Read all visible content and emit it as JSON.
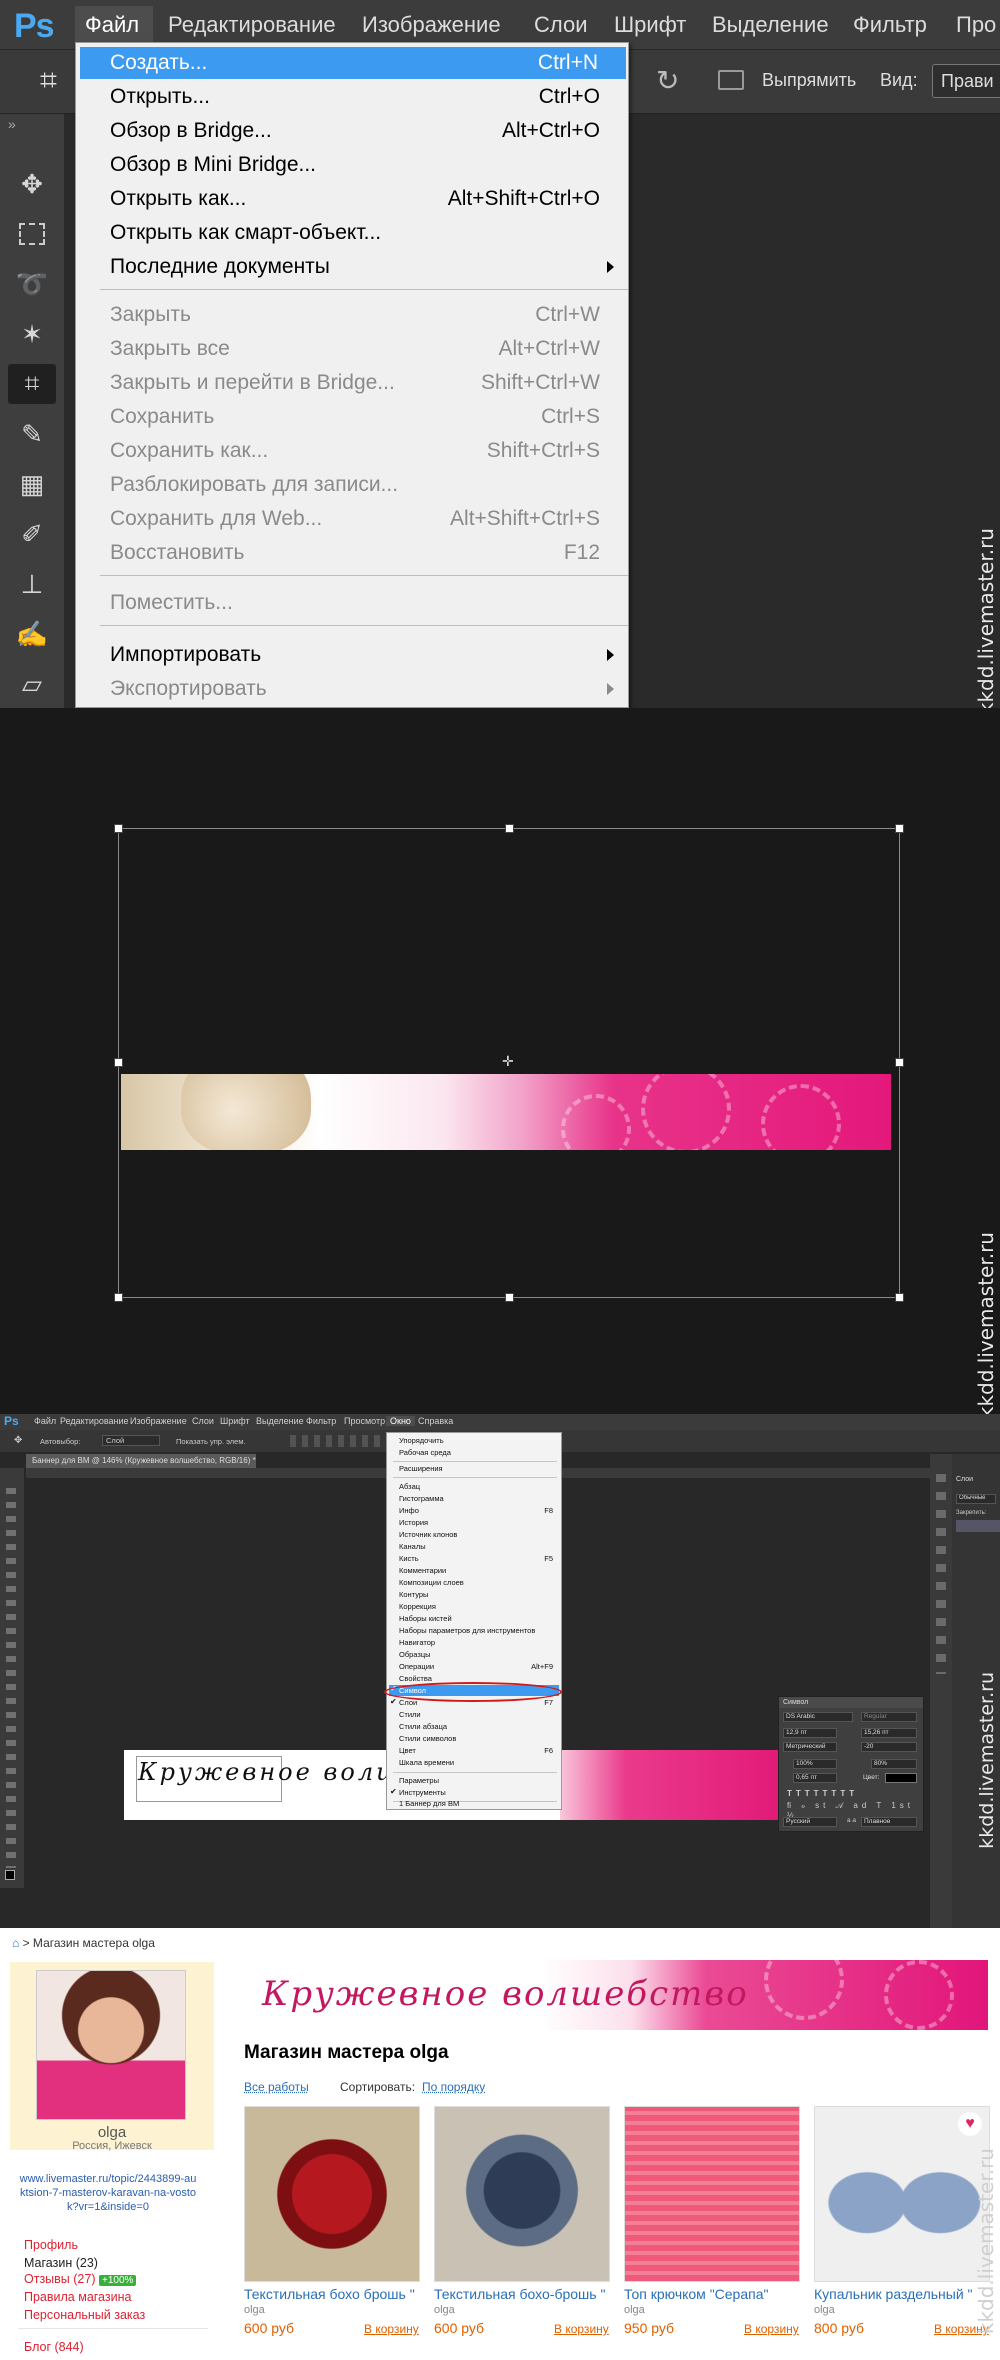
{
  "watermark": "kkdd.livemaster.ru",
  "p1": {
    "logo": "Ps",
    "menubar": [
      "Файл",
      "Редактирование",
      "Изображение",
      "Слои",
      "Шрифт",
      "Выделение",
      "Фильтр",
      "Про"
    ],
    "options": {
      "straighten": "Выпрямить",
      "view_label": "Вид:",
      "view_value": "Прави"
    },
    "file_menu": [
      {
        "label": "Создать...",
        "shortcut": "Ctrl+N",
        "state": "highlighted"
      },
      {
        "label": "Открыть...",
        "shortcut": "Ctrl+O"
      },
      {
        "label": "Обзор в Bridge...",
        "shortcut": "Alt+Ctrl+O"
      },
      {
        "label": "Обзор в Mini Bridge...",
        "shortcut": ""
      },
      {
        "label": "Открыть как...",
        "shortcut": "Alt+Shift+Ctrl+O"
      },
      {
        "label": "Открыть как смарт-объект...",
        "shortcut": ""
      },
      {
        "label": "Последние документы",
        "shortcut": "",
        "submenu": true
      },
      {
        "label": "Закрыть",
        "shortcut": "Ctrl+W",
        "state": "disabled"
      },
      {
        "label": "Закрыть все",
        "shortcut": "Alt+Ctrl+W",
        "state": "disabled"
      },
      {
        "label": "Закрыть и перейти в Bridge...",
        "shortcut": "Shift+Ctrl+W",
        "state": "disabled"
      },
      {
        "label": "Сохранить",
        "shortcut": "Ctrl+S",
        "state": "disabled"
      },
      {
        "label": "Сохранить как...",
        "shortcut": "Shift+Ctrl+S",
        "state": "disabled"
      },
      {
        "label": "Разблокировать для записи...",
        "shortcut": "",
        "state": "disabled"
      },
      {
        "label": "Сохранить для Web...",
        "shortcut": "Alt+Shift+Ctrl+S",
        "state": "disabled"
      },
      {
        "label": "Восстановить",
        "shortcut": "F12",
        "state": "disabled"
      },
      {
        "label": "Поместить...",
        "shortcut": "",
        "state": "disabled"
      },
      {
        "label": "Импортировать",
        "shortcut": "",
        "submenu": true
      },
      {
        "label": "Экспортировать",
        "shortcut": "",
        "submenu": true,
        "state": "disabled"
      }
    ]
  },
  "p3": {
    "logo": "Ps",
    "menubar": [
      "Файл",
      "Редактирование",
      "Изображение",
      "Слои",
      "Шрифт",
      "Выделение",
      "Фильтр",
      "Просмотр",
      "Окно",
      "Справка"
    ],
    "options": {
      "autoselect": "Автовыбор:",
      "layer": "Слой",
      "transform": "Показать упр. элем."
    },
    "doc_tab": "Баннер для ВМ @ 146% (Кружевное волшебство, RGB/16) *",
    "window_menu": [
      {
        "label": "Упорядочить",
        "sc": ""
      },
      {
        "label": "Рабочая среда",
        "sc": ""
      },
      {
        "label": "Расширения",
        "sc": ""
      },
      {
        "label": "Абзац",
        "sc": ""
      },
      {
        "label": "Гистограмма",
        "sc": ""
      },
      {
        "label": "Инфо",
        "sc": "F8"
      },
      {
        "label": "История",
        "sc": ""
      },
      {
        "label": "Источник клонов",
        "sc": ""
      },
      {
        "label": "Каналы",
        "sc": ""
      },
      {
        "label": "Кисть",
        "sc": "F5"
      },
      {
        "label": "Комментарии",
        "sc": ""
      },
      {
        "label": "Композиции слоев",
        "sc": ""
      },
      {
        "label": "Контуры",
        "sc": ""
      },
      {
        "label": "Коррекция",
        "sc": ""
      },
      {
        "label": "Наборы кистей",
        "sc": ""
      },
      {
        "label": "Наборы параметров для инструментов",
        "sc": ""
      },
      {
        "label": "Навигатор",
        "sc": ""
      },
      {
        "label": "Образцы",
        "sc": ""
      },
      {
        "label": "Операции",
        "sc": "Alt+F9"
      },
      {
        "label": "Свойства",
        "sc": ""
      },
      {
        "label": "Символ",
        "sc": "",
        "hl": true
      },
      {
        "label": "Слои",
        "sc": "F7"
      },
      {
        "label": "Стили",
        "sc": ""
      },
      {
        "label": "Стили абзаца",
        "sc": ""
      },
      {
        "label": "Стили символов",
        "sc": ""
      },
      {
        "label": "Цвет",
        "sc": "F6"
      },
      {
        "label": "Шкала времени",
        "sc": ""
      },
      {
        "label": "Параметры",
        "sc": ""
      },
      {
        "label": "Инструменты",
        "sc": ""
      },
      {
        "label": "1 Баннер для ВМ",
        "sc": ""
      }
    ],
    "canvas_text": "Кружевное волшебст",
    "char_panel": {
      "title": "Символ",
      "font": "DS Arabic",
      "style": "Regular",
      "size": "12,9 пт",
      "leading": "15,26 пт",
      "kerning": "Метрический",
      "tracking": "-20",
      "scale_v": "100%",
      "scale_h": "80%",
      "baseline": "0,65 пт",
      "color_label": "Цвет:",
      "lang": "Русский",
      "aa": "Плавное",
      "aa_label": "a a"
    },
    "layers_panel": {
      "tab": "Слои",
      "blend": "Обычные",
      "lock": "Закрепить:"
    }
  },
  "p4": {
    "breadcrumb_home": "⌂",
    "breadcrumb": "> Магазин мастера olga",
    "user": {
      "name": "olga",
      "location": "Россия, Ижевск"
    },
    "link": "www.livemaster.ru/topic/2443899-auktsion-7-masterov-karavan-na-vostok?vr=1&inside=0",
    "menu": {
      "profile": "Профиль",
      "shop": "Магазин",
      "shop_count": "(23)",
      "reviews": "Отзывы (27)",
      "reviews_badge": "+100%",
      "rules": "Правила магазина",
      "order": "Персональный заказ",
      "blog": "Блог (844)"
    },
    "banner_text": "Кружевное волшебство",
    "shop_title": "Магазин мастера olga",
    "filters": {
      "all": "Все работы",
      "sort_label": "Сортировать:",
      "sort_value": "По порядку"
    },
    "products": [
      {
        "title": "Текстильная бохо брошь \"",
        "author": "olga",
        "price": "600 руб",
        "cart": "В корзину"
      },
      {
        "title": "Текстильная бохо-брошь \"",
        "author": "olga",
        "price": "600 руб",
        "cart": "В корзину"
      },
      {
        "title": "Топ крючком \"Серапа\"",
        "author": "olga",
        "price": "950 руб",
        "cart": "В корзину"
      },
      {
        "title": "Купальник раздельный \"",
        "author": "olga",
        "price": "800 руб",
        "cart": "В корзину"
      }
    ]
  }
}
